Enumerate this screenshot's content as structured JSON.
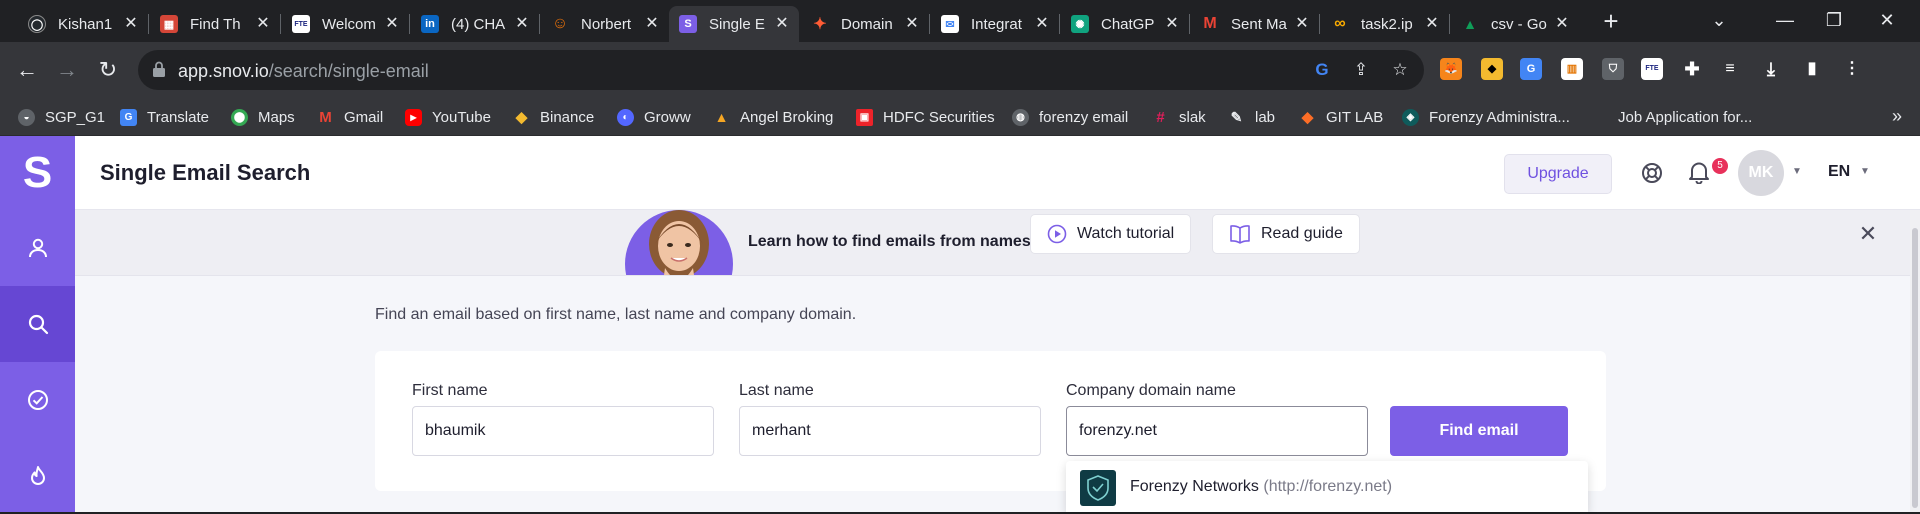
{
  "browser": {
    "tabs": [
      {
        "title": "Kishan1",
        "color": "#24292e",
        "glyph": "◯"
      },
      {
        "title": "Find Th",
        "color": "#d44638",
        "glyph": "▦"
      },
      {
        "title": "Welcom",
        "color": "#ffffff",
        "glyph": "FTE"
      },
      {
        "title": "(4) CHA",
        "color": "#0a66c2",
        "glyph": "in"
      },
      {
        "title": "Norbert",
        "color": "#e8710a",
        "glyph": "☺"
      },
      {
        "title": "Single E",
        "color": "#7c5fe6",
        "glyph": "S"
      },
      {
        "title": "Domain",
        "color": "#ff5c35",
        "glyph": "✦"
      },
      {
        "title": "Integrat",
        "color": "#4285f4",
        "glyph": "✉"
      },
      {
        "title": "ChatGP",
        "color": "#10a37f",
        "glyph": "✺"
      },
      {
        "title": "Sent Ma",
        "color": "#ea4335",
        "glyph": "M"
      },
      {
        "title": "task2.ip",
        "color": "#f9ab00",
        "glyph": "∞"
      },
      {
        "title": "csv - Go",
        "color": "#0f9d58",
        "glyph": "▲"
      }
    ],
    "url_host": "app.snov.io",
    "url_path": "/search/single-email",
    "bookmarks": [
      {
        "label": "SGP_G1",
        "color": "#5f6368",
        "glyph": "◒"
      },
      {
        "label": "Translate",
        "color": "#4285f4",
        "glyph": "G"
      },
      {
        "label": "Maps",
        "color": "#34a853",
        "glyph": "⬤"
      },
      {
        "label": "Gmail",
        "color": "#ea4335",
        "glyph": "M"
      },
      {
        "label": "YouTube",
        "color": "#ff0000",
        "glyph": "▶"
      },
      {
        "label": "Binance",
        "color": "#f3ba2f",
        "glyph": "◆"
      },
      {
        "label": "Groww",
        "color": "#5367ff",
        "glyph": "◐"
      },
      {
        "label": "Angel Broking",
        "color": "#f5a623",
        "glyph": "▲"
      },
      {
        "label": "HDFC Securities",
        "color": "#ed232a",
        "glyph": "▣"
      },
      {
        "label": "forenzy email",
        "color": "#5f6368",
        "glyph": "◍"
      },
      {
        "label": "slak",
        "color": "#4a154b",
        "glyph": "#"
      },
      {
        "label": "lab",
        "color": "#5f6368",
        "glyph": "✎"
      },
      {
        "label": "GIT LAB",
        "color": "#fc6d26",
        "glyph": "◆"
      },
      {
        "label": "Forenzy Administra...",
        "color": "#0f5b5b",
        "glyph": "◈"
      },
      {
        "label": "Job Application for...",
        "color": "#35363a",
        "glyph": ""
      }
    ]
  },
  "app": {
    "logo": "S",
    "page_title": "Single Email Search",
    "upgrade_label": "Upgrade",
    "notifications_count": "5",
    "avatar_initials": "MK",
    "language": "EN",
    "banner": {
      "text": "Learn how to find emails from names",
      "watch_label": "Watch tutorial",
      "guide_label": "Read guide"
    },
    "description": "Find an email based on first name, last name and company domain.",
    "form": {
      "first_name_label": "First name",
      "first_name_value": "bhaumik",
      "last_name_label": "Last name",
      "last_name_value": "merhant",
      "domain_label": "Company domain name",
      "domain_value": "forenzy.net",
      "submit_label": "Find email"
    },
    "suggestion": {
      "name": "Forenzy Networks",
      "url": "(http://forenzy.net)"
    },
    "accent_color": "#7c5fe6"
  }
}
